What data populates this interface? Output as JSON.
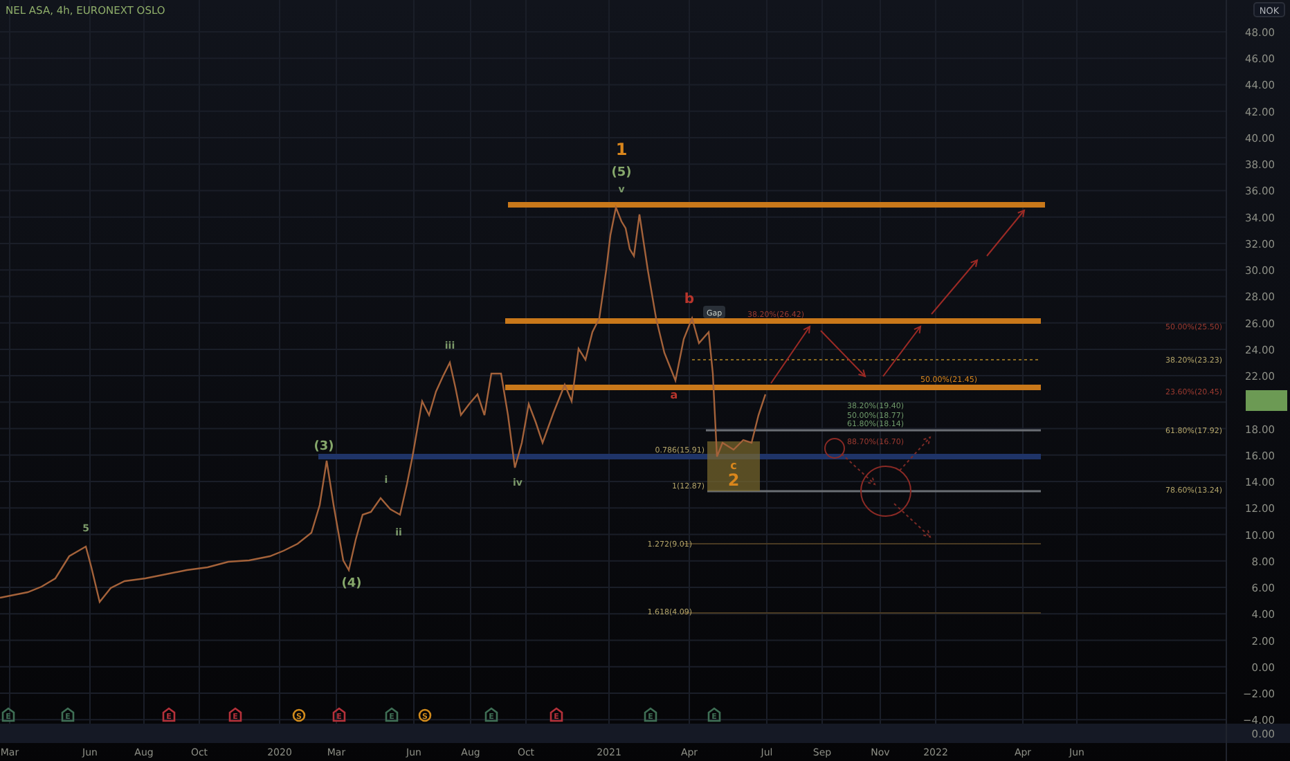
{
  "header": {
    "title": "NEL ASA, 4h, EURONEXT OSLO"
  },
  "price_axis": {
    "currency": "NOK",
    "labels": [
      "48.00",
      "46.00",
      "44.00",
      "42.00",
      "40.00",
      "38.00",
      "36.00",
      "34.00",
      "32.00",
      "30.00",
      "28.00",
      "26.00",
      "24.00",
      "22.00",
      "18.00",
      "16.00",
      "14.00",
      "12.00",
      "10.00",
      "8.00",
      "6.00",
      "4.00",
      "2.00",
      "0.00",
      "−2.00",
      "−4.00"
    ],
    "lower_pane_label": "0.00"
  },
  "time_axis": {
    "labels": [
      "Mar",
      "Jun",
      "Aug",
      "Oct",
      "2020",
      "Mar",
      "Jun",
      "Aug",
      "Oct",
      "2021",
      "Apr",
      "Jul",
      "Sep",
      "Nov",
      "2022",
      "Apr",
      "Jun"
    ]
  },
  "wave_labels": [
    {
      "text": "5",
      "color": "#7c9a6a"
    },
    {
      "text": "(3)",
      "color": "#86a86b"
    },
    {
      "text": "(4)",
      "color": "#86a86b"
    },
    {
      "text": "i",
      "color": "#7c9a6a"
    },
    {
      "text": "ii",
      "color": "#7c9a6a"
    },
    {
      "text": "iii",
      "color": "#7c9a6a"
    },
    {
      "text": "iv",
      "color": "#7c9a6a"
    },
    {
      "text": "1",
      "color": "#d9861c"
    },
    {
      "text": "(5)",
      "color": "#86a86b"
    },
    {
      "text": "v",
      "color": "#7c9a6a"
    },
    {
      "text": "b",
      "color": "#b8352c"
    },
    {
      "text": "a",
      "color": "#b8352c"
    },
    {
      "text": "c",
      "color": "#d9861c"
    },
    {
      "text": "2",
      "color": "#d9861c"
    }
  ],
  "gap_badge": "Gap",
  "fib_labels": [
    {
      "text": "38.20%(26.42)",
      "color": "#9c3a30"
    },
    {
      "text": "50.00%(25.50)",
      "color": "#9c3a30"
    },
    {
      "text": "38.20%(23.23)",
      "color": "#b5a66a"
    },
    {
      "text": "50.00%(21.45)",
      "color": "#d9861c"
    },
    {
      "text": "23.60%(20.45)",
      "color": "#9c3a30"
    },
    {
      "text": "38.20%(19.40)",
      "color": "#6f9a6a"
    },
    {
      "text": "50.00%(18.77)",
      "color": "#6f9a6a"
    },
    {
      "text": "61.80%(18.14)",
      "color": "#6f9a6a"
    },
    {
      "text": "61.80%(17.92)",
      "color": "#b5a66a"
    },
    {
      "text": "88.70%(16.70)",
      "color": "#9c3a30"
    },
    {
      "text": "0.786(15.91)",
      "color": "#b5a66a"
    },
    {
      "text": "1(12.87)",
      "color": "#b5a66a"
    },
    {
      "text": "78.60%(13.24)",
      "color": "#b5a66a"
    },
    {
      "text": "1.272(9.01)",
      "color": "#b5a66a"
    },
    {
      "text": "1.618(4.09)",
      "color": "#b5a66a"
    }
  ],
  "events": [
    {
      "letter": "E",
      "color": "#3f6f55"
    },
    {
      "letter": "E",
      "color": "#3f6f55"
    },
    {
      "letter": "E",
      "color": "#b5313a"
    },
    {
      "letter": "E",
      "color": "#b5313a"
    },
    {
      "letter": "S",
      "color": "#d08a1c"
    },
    {
      "letter": "E",
      "color": "#b5313a"
    },
    {
      "letter": "E",
      "color": "#3f6f55"
    },
    {
      "letter": "S",
      "color": "#d08a1c"
    },
    {
      "letter": "E",
      "color": "#3f6f55"
    },
    {
      "letter": "E",
      "color": "#b5313a"
    },
    {
      "letter": "E",
      "color": "#3f6f55"
    },
    {
      "letter": "E",
      "color": "#3f6f55"
    }
  ]
}
